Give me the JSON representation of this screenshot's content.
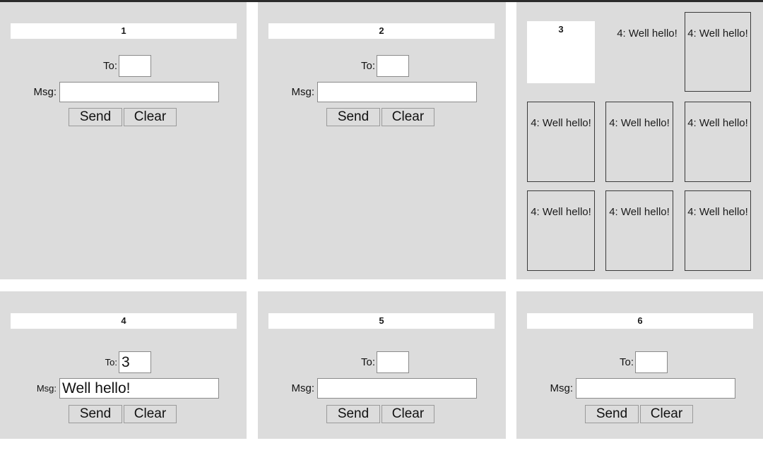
{
  "theme": {
    "panel_bg": "#dcdcdc",
    "page_bg": "#ffffff",
    "title_bg": "#ffffff",
    "input_bg": "#ffffff",
    "input_border": "#8a8a8a",
    "button_bg": "#dcdcdc",
    "button_border": "#9a9a9a",
    "msgbox_border": "#3a3a3a",
    "text": "#111111",
    "top_rule": "#2b2b2b"
  },
  "labels": {
    "to": "To:",
    "msg": "Msg:",
    "send": "Send",
    "clear": "Clear"
  },
  "panels": [
    {
      "kind": "form",
      "title": "1",
      "to_value": "",
      "to_placeholder": "",
      "msg_value": "",
      "msg_placeholder": ""
    },
    {
      "kind": "form",
      "title": "2",
      "to_value": "",
      "to_placeholder": "",
      "msg_value": "",
      "msg_placeholder": ""
    },
    {
      "kind": "messages",
      "title": "3",
      "plain_message": "4: Well hello!",
      "boxed_messages": [
        "4: Well hello!",
        "4: Well hello!",
        "4: Well hello!",
        "4: Well hello!",
        "4: Well hello!",
        "4: Well hello!",
        "4: Well hello!"
      ]
    },
    {
      "kind": "form",
      "title": "4",
      "to_value": "3",
      "to_placeholder": "",
      "msg_value": "Well hello!",
      "msg_placeholder": ""
    },
    {
      "kind": "form",
      "title": "5",
      "to_value": "",
      "to_placeholder": "",
      "msg_value": "",
      "msg_placeholder": ""
    },
    {
      "kind": "form",
      "title": "6",
      "to_value": "",
      "to_placeholder": "",
      "msg_value": "",
      "msg_placeholder": ""
    }
  ]
}
